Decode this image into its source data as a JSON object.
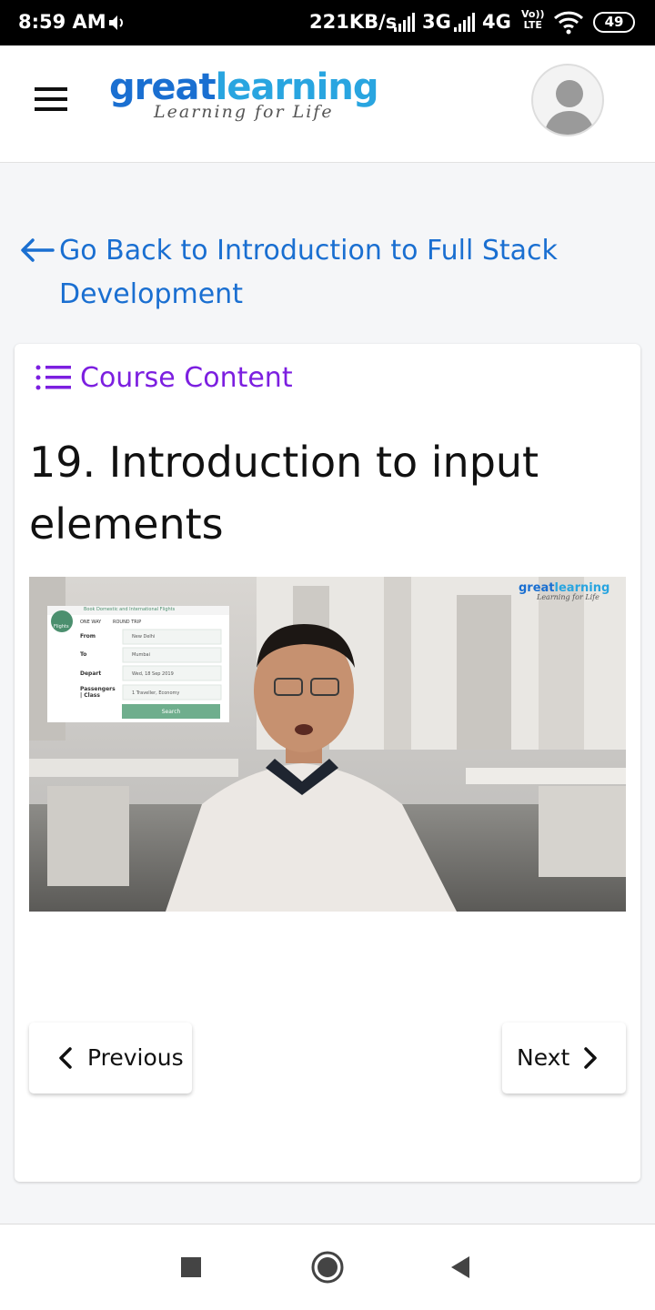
{
  "status_bar": {
    "time": "8:59 AM",
    "speed": "221KB/s",
    "net_3g": "3G",
    "net_4g": "4G",
    "volte_top": "Vo))",
    "volte_bottom": "LTE",
    "battery": "49",
    "icons": [
      "volume-icon",
      "signal-icon",
      "signal-icon",
      "wifi-icon",
      "battery-icon"
    ]
  },
  "header": {
    "logo_great": "great",
    "logo_learning": "learning",
    "logo_tagline": "Learning for Life",
    "menu_icon": "hamburger-menu-icon",
    "avatar_icon": "user-avatar-icon"
  },
  "back_link": {
    "label": "Go Back to Introduction to Full Stack Development",
    "icon": "arrow-left-icon"
  },
  "course": {
    "content_label": "Course Content",
    "content_icon": "list-icon",
    "lesson_title": "19. Introduction to input elements"
  },
  "video": {
    "watermark_great": "great",
    "watermark_learning": "learning",
    "watermark_tagline": "Learning for Life",
    "form": {
      "tab_label": "Book Domestic and International Flights",
      "badge": "Flights",
      "one_way": "ONE WAY",
      "round_trip": "ROUND TRIP",
      "from_label": "From",
      "from_value": "New Delhi",
      "to_label": "To",
      "to_value": "Mumbai",
      "depart_label": "Depart",
      "depart_value": "Wed, 18 Sep 2019",
      "pass_label": "Passengers | Class",
      "pass_value": "1 Traveller, Economy",
      "search": "Search"
    }
  },
  "navigation": {
    "previous": "Previous",
    "next": "Next"
  },
  "colors": {
    "link_blue": "#1a6fd1",
    "course_purple": "#7c1fe0",
    "logo_great": "#1a6fd1",
    "logo_learning": "#29a5e0"
  }
}
